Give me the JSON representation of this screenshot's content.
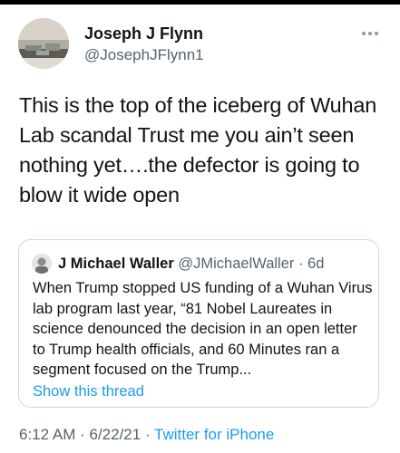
{
  "author": {
    "name": "Joseph J Flynn",
    "handle": "@JosephJFlynn1"
  },
  "tweet": {
    "text": "This is the top of the iceberg of Wuhan Lab scandal Trust me you ain’t seen nothing yet….the defector is going to blow it wide open"
  },
  "quote": {
    "name": "J Michael Waller",
    "handle": "@JMichaelWaller",
    "separator": " · ",
    "age": "6d",
    "text": "When Trump stopped US funding of a Wuhan Virus lab program last year, “81 Nobel Laureates in science denounced the decision in an open letter to Trump health officials, and 60 Minutes ran a segment focused on the Trump...",
    "show_thread": "Show this thread"
  },
  "meta": {
    "time": "6:12 AM",
    "separator": " · ",
    "date": "6/22/21",
    "source": "Twitter for iPhone"
  },
  "icons": {
    "more": "more-horizontal-icon"
  },
  "colors": {
    "link": "#1d9bf0",
    "secondary_text": "#536471",
    "border": "#cfd9de"
  }
}
